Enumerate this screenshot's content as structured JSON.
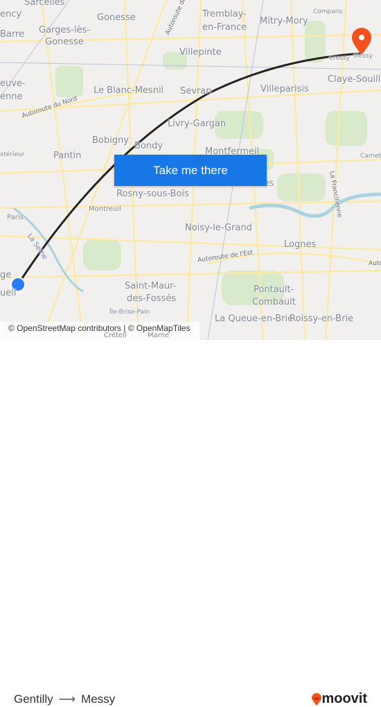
{
  "map": {
    "labels": {
      "sarcelles": "Sarcelles",
      "gonesse": "Gonesse",
      "tremblay": "Tremblay-",
      "tremblay2": "en-France",
      "mitry": "Mitry-Mory",
      "compans": "Compans",
      "ency": "ency",
      "barre": "Barre",
      "garges": "Garges-lès-",
      "garges2": "Gonesse",
      "villepinte": "Villepinte",
      "messy": "Messy",
      "cressy": "Cressy",
      "euve": "euve-",
      "enne": "enne",
      "blanc": "Le Blanc-Mesnil",
      "sevran": "Sevran",
      "villeparisis": "Villeparisis",
      "claye": "Claye-Souilly",
      "livry": "Livry-Gargan",
      "bobigny": "Bobigny",
      "bondy": "Bondy",
      "montfermeil": "Montfermeil",
      "carnet": "Carnet",
      "exterieur": "xtérieur",
      "pantin": "Pantin",
      "chelles": "Chelles",
      "rosny": "Rosny-sous-Bois",
      "montreuil": "Montreuil",
      "paris": "Paris",
      "seine": "La Seine",
      "noisy": "Noisy-le-Grand",
      "lognes": "Lognes",
      "ge": "ge",
      "gentilly_cut": "uell",
      "saintmaur": "Saint-Maur-",
      "saintmaur2": "des-Fossés",
      "pontault": "Pontault-",
      "pontault2": "Combault",
      "ilebrisepain": "Île-Brise-Pain",
      "queue": "La Queue-en-Brie",
      "roissy": "Roissy-en-Brie",
      "creteil": "Créteil",
      "marne": "Marne",
      "auto_nord": "Autoroute du Nord",
      "auto_est": "Autoroute de l'Est",
      "auto_du": "Autoroute du",
      "francilienne": "La Francilienne",
      "auto_r": "Auto"
    },
    "origin_color": "#2a7cf5",
    "destination_color": "#f4511e",
    "route_color": "#222222"
  },
  "cta": {
    "label": "Take me there"
  },
  "attribution": "© OpenStreetMap contributors | © OpenMapTiles",
  "footer": {
    "from": "Gentilly",
    "to": "Messy",
    "arrow": "⟶",
    "brand": "moovit"
  }
}
